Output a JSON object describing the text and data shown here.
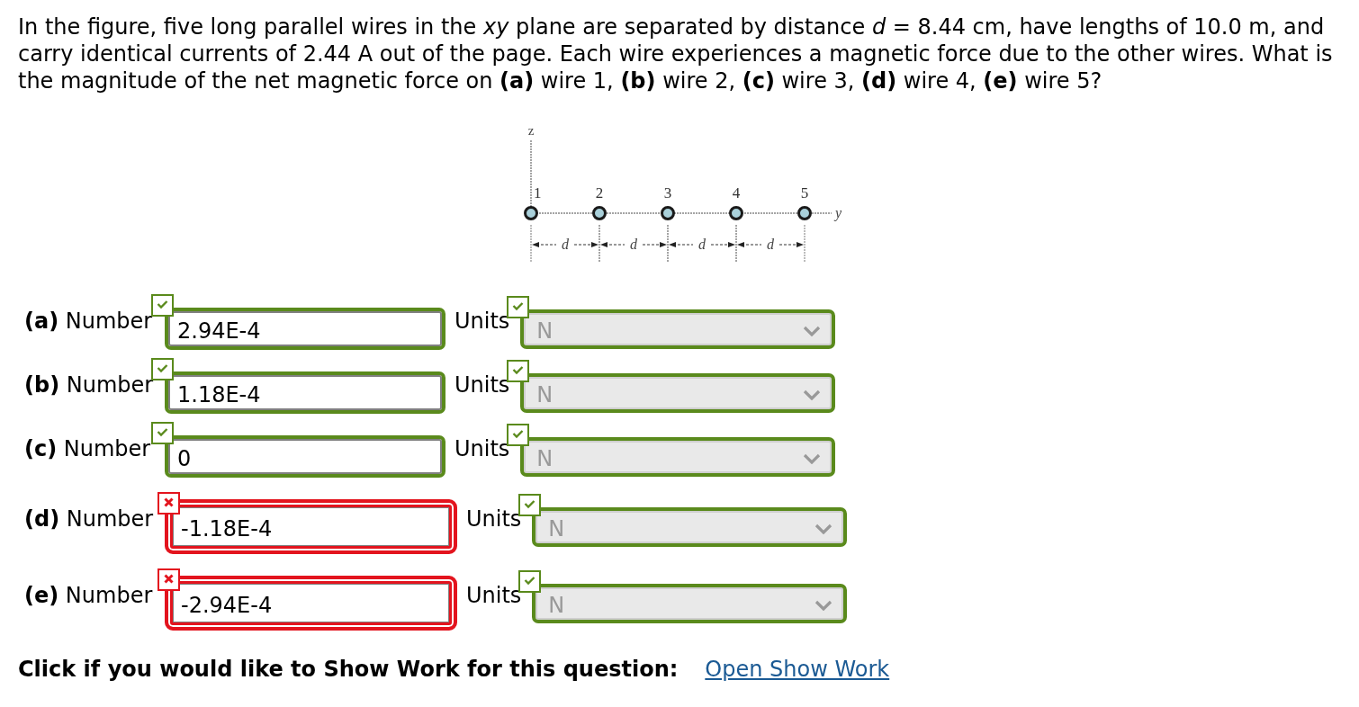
{
  "question": "In the figure, five long parallel wires in the *xy* plane are separated by distance *d* = 8.44 cm, have lengths of 10.0 m, and carry identical currents of 2.44 A out of the page. Each wire experiences a magnetic force due to the other wires. What is the magnitude of the net magnetic force on **(a)** wire 1, **(b)** wire 2, **(c)** wire 3, **(d)** wire 4, **(e)** wire 5?",
  "figure": {
    "axis_labels": [
      "z",
      "y"
    ],
    "wires": [
      "1",
      "2",
      "3",
      "4",
      "5"
    ],
    "spacing_labels": [
      "d",
      "d",
      "d",
      "d"
    ]
  },
  "answers": [
    {
      "label": "**(a)** Number",
      "value": "2.94E-4",
      "correct": true,
      "units_label": "Units",
      "units": "N",
      "units_correct": true
    },
    {
      "label": "**(b)** Number",
      "value": "1.18E-4",
      "correct": true,
      "units_label": "Units",
      "units": "N",
      "units_correct": true
    },
    {
      "label": "**(c)** Number",
      "value": "0",
      "correct": true,
      "units_label": "Units",
      "units": "N",
      "units_correct": true
    },
    {
      "label": "**(d)** Number",
      "value": "-1.18E-4",
      "correct": false,
      "units_label": "Units",
      "units": "N",
      "units_correct": true
    },
    {
      "label": "**(e)** Number",
      "value": "-2.94E-4",
      "correct": false,
      "units_label": "Units",
      "units": "N",
      "units_correct": true
    }
  ],
  "show_work": {
    "prompt": "Click if you would like to Show Work for this question:",
    "link": "Open Show Work"
  }
}
